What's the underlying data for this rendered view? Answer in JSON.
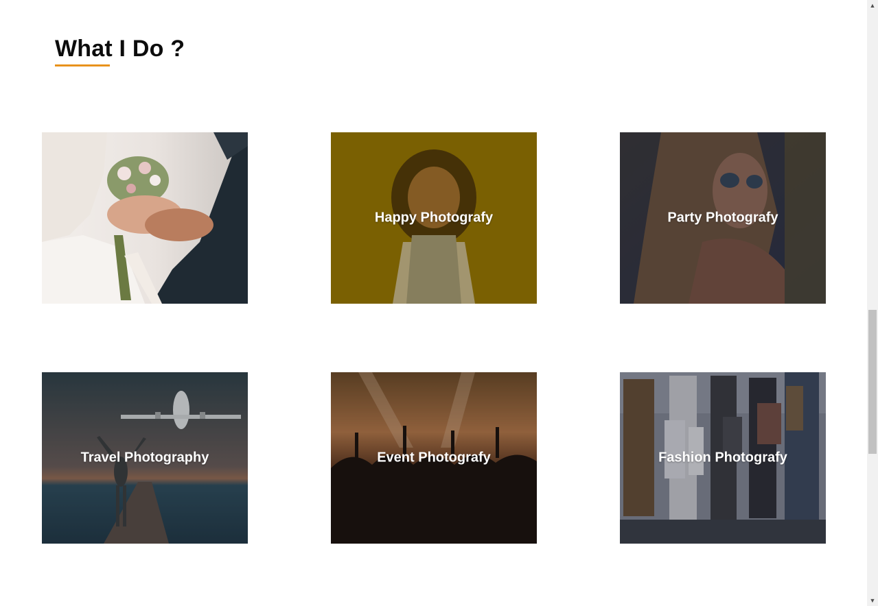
{
  "section": {
    "title": "What I Do ?",
    "accent_color": "#e8921c"
  },
  "services": [
    {
      "label": "",
      "image": "wedding-rings-photo"
    },
    {
      "label": "Happy Photografy",
      "image": "smiling-girl-photo"
    },
    {
      "label": "Party Photografy",
      "image": "woman-sunglasses-photo"
    },
    {
      "label": "Travel Photography",
      "image": "airplane-beach-photo"
    },
    {
      "label": "Event Photografy",
      "image": "concert-crowd-photo"
    },
    {
      "label": "Fashion Photografy",
      "image": "shopping-group-photo"
    }
  ],
  "scrollbar": {
    "up_arrow": "▲",
    "down_arrow": "▼"
  }
}
